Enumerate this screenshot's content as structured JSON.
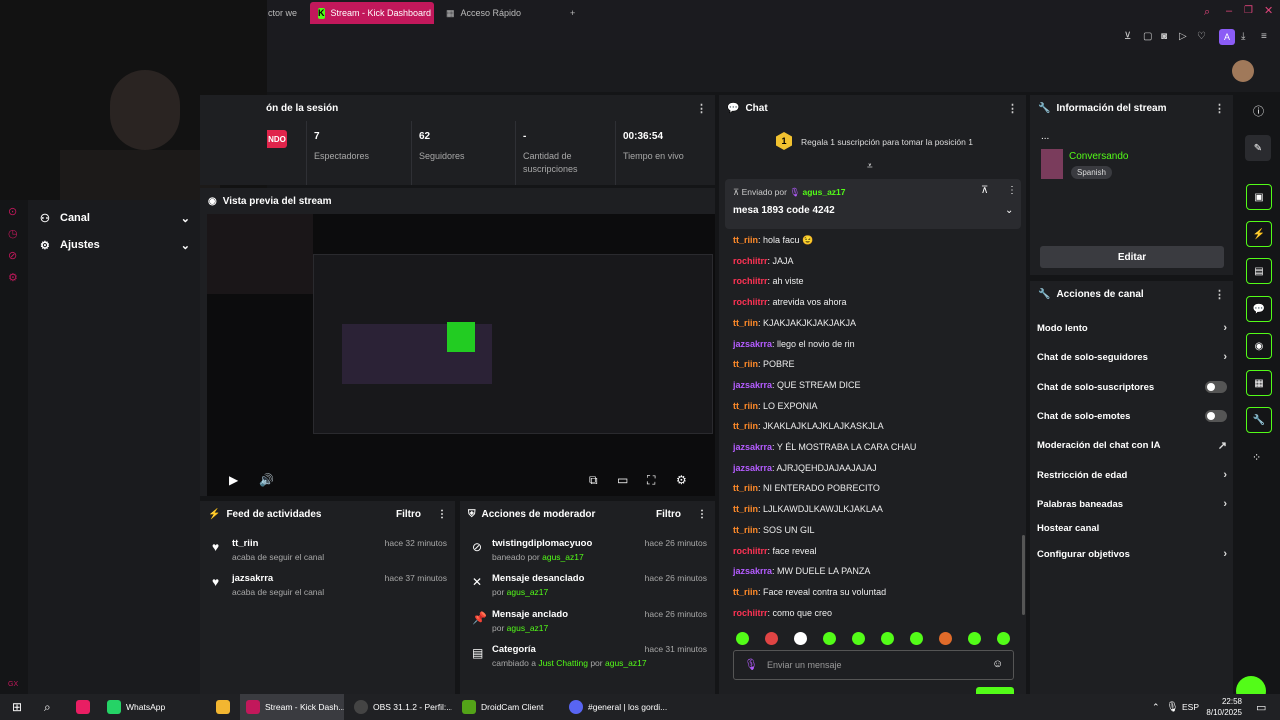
{
  "browser": {
    "tabs": [
      {
        "label": "ctor we"
      },
      {
        "label": "Stream - Kick Dashboard"
      },
      {
        "label": "Acceso Rápido"
      }
    ],
    "new_tab": "+",
    "profile": "A"
  },
  "session": {
    "title": "ón de la sesión",
    "live_badge": "NDO",
    "stats": [
      {
        "value": "7",
        "label": "Espectadores"
      },
      {
        "value": "62",
        "label": "Seguidores"
      },
      {
        "value": "-",
        "label": "Cantidad de suscripciones"
      },
      {
        "value": "00:36:54",
        "label": "Tiempo en vivo"
      }
    ]
  },
  "sidebar": {
    "items": [
      {
        "label": "Canal"
      },
      {
        "label": "Ajustes"
      }
    ]
  },
  "preview": {
    "title": "Vista previa del stream"
  },
  "feed": {
    "title": "Feed de actividades",
    "filter": "Filtro",
    "items": [
      {
        "name": "tt_riin",
        "sub": "acaba de seguir el canal",
        "time": "hace 32 minutos"
      },
      {
        "name": "jazsakrra",
        "sub": "acaba de seguir el canal",
        "time": "hace 37 minutos"
      }
    ]
  },
  "mod": {
    "title": "Acciones de moderador",
    "filter": "Filtro",
    "items": [
      {
        "title": "twistingdiplomacyuoo",
        "pre": "baneado por",
        "user": "agus_az17",
        "time": "hace 26 minutos"
      },
      {
        "title": "Mensaje desanclado",
        "pre": "por",
        "user": "agus_az17",
        "time": "hace 26 minutos"
      },
      {
        "title": "Mensaje anclado",
        "pre": "por",
        "user": "agus_az17",
        "time": "hace 26 minutos"
      },
      {
        "title": "Categoría",
        "pre": "cambiado a",
        "cat": "Just Chatting",
        "mid": "por",
        "user": "agus_az17",
        "time": "hace 31 minutos"
      }
    ]
  },
  "chat": {
    "title": "Chat",
    "gift_text": "Regala 1 suscripción para tomar la posición 1",
    "gift_pos": "1",
    "pinned_by_label": "Enviado por",
    "pinned_user": "agus_az17",
    "pinned_msg": "mesa 1893 code 4242",
    "input_placeholder": "Enviar un mensaje",
    "messages": [
      {
        "user": "tt_riin",
        "text": ": hola facu 😉",
        "color": "#ff8a2a"
      },
      {
        "user": "rochiitrr",
        "text": ": JAJA",
        "color": "#ff3355"
      },
      {
        "user": "rochiitrr",
        "text": ": ah viste",
        "color": "#ff3355"
      },
      {
        "user": "rochiitrr",
        "text": ": atrevida vos ahora",
        "color": "#ff3355"
      },
      {
        "user": "tt_riin",
        "text": ": KJAKJAKJKJAKJAKJA",
        "color": "#ff8a2a"
      },
      {
        "user": "jazsakrra",
        "text": ": llego el novio de rin",
        "color": "#b45cff"
      },
      {
        "user": "tt_riin",
        "text": ": POBRE",
        "color": "#ff8a2a"
      },
      {
        "user": "jazsakrra",
        "text": ": QUE STREAM DICE",
        "color": "#b45cff"
      },
      {
        "user": "tt_riin",
        "text": ": LO EXPONIA",
        "color": "#ff8a2a"
      },
      {
        "user": "tt_riin",
        "text": ": JKAKLAJKLAJKLAJKASKJLA",
        "color": "#ff8a2a"
      },
      {
        "user": "jazsakrra",
        "text": ": Y ÉL MOSTRABA LA CARA CHAU",
        "color": "#b45cff"
      },
      {
        "user": "jazsakrra",
        "text": ": AJRJQEHDJAJAAJAJAJ",
        "color": "#b45cff"
      },
      {
        "user": "tt_riin",
        "text": ": NI ENTERADO POBRECITO",
        "color": "#ff8a2a"
      },
      {
        "user": "tt_riin",
        "text": ": LJLKAWDJLKAWJLKJAKLAA",
        "color": "#ff8a2a"
      },
      {
        "user": "tt_riin",
        "text": ": SOS UN GIL",
        "color": "#ff8a2a"
      },
      {
        "user": "rochiitrr",
        "text": ": face reveal",
        "color": "#ff3355"
      },
      {
        "user": "jazsakrra",
        "text": ": MW DUELE LA PANZA",
        "color": "#b45cff"
      },
      {
        "user": "tt_riin",
        "text": ": Face reveal contra su voluntad",
        "color": "#ff8a2a"
      },
      {
        "user": "rochiitrr",
        "text": ": como que creo",
        "color": "#ff3355"
      }
    ]
  },
  "info": {
    "title": "Información del stream",
    "ellipsis": "...",
    "category": "Conversando",
    "language": "Spanish",
    "edit": "Editar"
  },
  "actions": {
    "title": "Acciones de canal",
    "items": [
      {
        "label": "Modo lento",
        "ctl": "chev"
      },
      {
        "label": "Chat de solo-seguidores",
        "ctl": "chev"
      },
      {
        "label": "Chat de solo-suscriptores",
        "ctl": "toggle"
      },
      {
        "label": "Chat de solo-emotes",
        "ctl": "toggle"
      },
      {
        "label": "Moderación del chat con IA",
        "ctl": "link"
      },
      {
        "label": "Restricción de edad",
        "ctl": "chev"
      },
      {
        "label": "Palabras baneadas",
        "ctl": "chev"
      },
      {
        "label": "Hostear canal",
        "ctl": "none"
      },
      {
        "label": "Configurar objetivos",
        "ctl": "chev"
      }
    ]
  },
  "taskbar": {
    "apps": [
      {
        "label": "WhatsApp",
        "color": "#25d366"
      },
      {
        "label": "Stream - Kick Dash...",
        "color": "#c2185b"
      },
      {
        "label": "OBS 31.1.2 - Perfil:...",
        "color": "#444"
      },
      {
        "label": "DroidCam Client",
        "color": "#53a318"
      },
      {
        "label": "#general | los gordi...",
        "color": "#5865f2"
      }
    ],
    "lang": "ESP",
    "time": "22:58",
    "date": "8/10/2025"
  },
  "colors": {
    "accent": "#53fc18",
    "brand_tab": "#c2185b"
  }
}
